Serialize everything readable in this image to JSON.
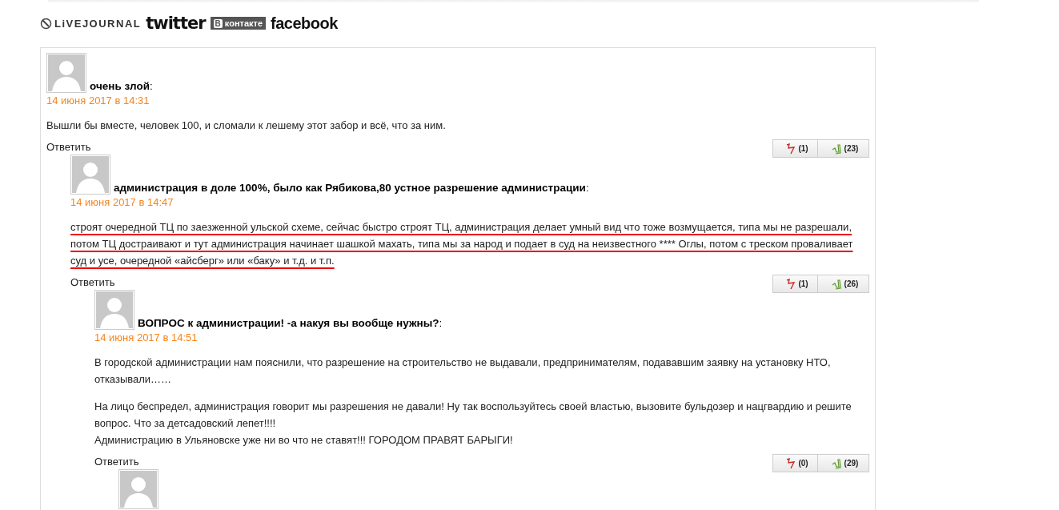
{
  "share_logos": [
    {
      "kind": "livejournal",
      "label": "LiVEJOURNAL"
    },
    {
      "kind": "twitter",
      "label": "twitter"
    },
    {
      "kind": "vk",
      "badge": "В",
      "label": "контакте"
    },
    {
      "kind": "facebook",
      "label": "facebook"
    }
  ],
  "comments": [
    {
      "kind": "comment",
      "author": "**очень злой**:",
      "date": "14 июня 2017 в 14:31",
      "underlined": false,
      "paragraphs": [
        "Вышли бы вместе, человек 100, и сломали к лешему этот забор и всё, что за ним."
      ],
      "reply": "Ответить",
      "dislikes": "(1)",
      "likes": "(23)",
      "children": [
        {
          "kind": "comment",
          "author": "**администрация в доле 100%, было как Рябикова,80 устное разрешение администрации**:",
          "date": "14 июня 2017 в 14:47",
          "underlined": true,
          "paragraphs": [
            "строят очередной ТЦ по заезженной ульской схеме, сейчас быстро строят ТЦ, администрация делает умный вид что тоже возмущается, типа мы не разрешали, потом ТЦ достраивают и тут администрация начинает шашкой махать, типа мы за народ и подает в суд на неизвестного **** Оглы, потом с треском проваливает суд и усе, очередной «айсберг» или «баку» и т.д. и т.п."
          ],
          "reply": "Ответить",
          "dislikes": "(1)",
          "likes": "(26)",
          "children": [
            {
              "kind": "comment",
              "author": "**ВОПРОС к администрации! -а накуя вы вообще нужны?**:",
              "date": "14 июня 2017 в 14:51",
              "underlined": false,
              "paragraphs": [
                "В городской администрации нам пояснили, что разрешение на строительство не выдавали, предпринимателям, подававшим заявку на установку НТО, отказывали……",
                "На лицо беспредел, администрация говорит мы разрешения не давали! Ну так воспользуйтесь своей властью, вызовите бульдозер и нацгвардию и решите вопрос. Что за детсадовский лепет!!!!\nАдминистрацию в Ульяновске уже ни во что не ставят!!! ГОРОДОМ ПРАВЯТ БАРЫГИ!"
              ],
              "reply": "Ответить",
              "dislikes": "(0)",
              "likes": "(29)",
              "children": [
                {
                  "kind": "avatar-only"
                }
              ]
            }
          ]
        }
      ]
    }
  ]
}
